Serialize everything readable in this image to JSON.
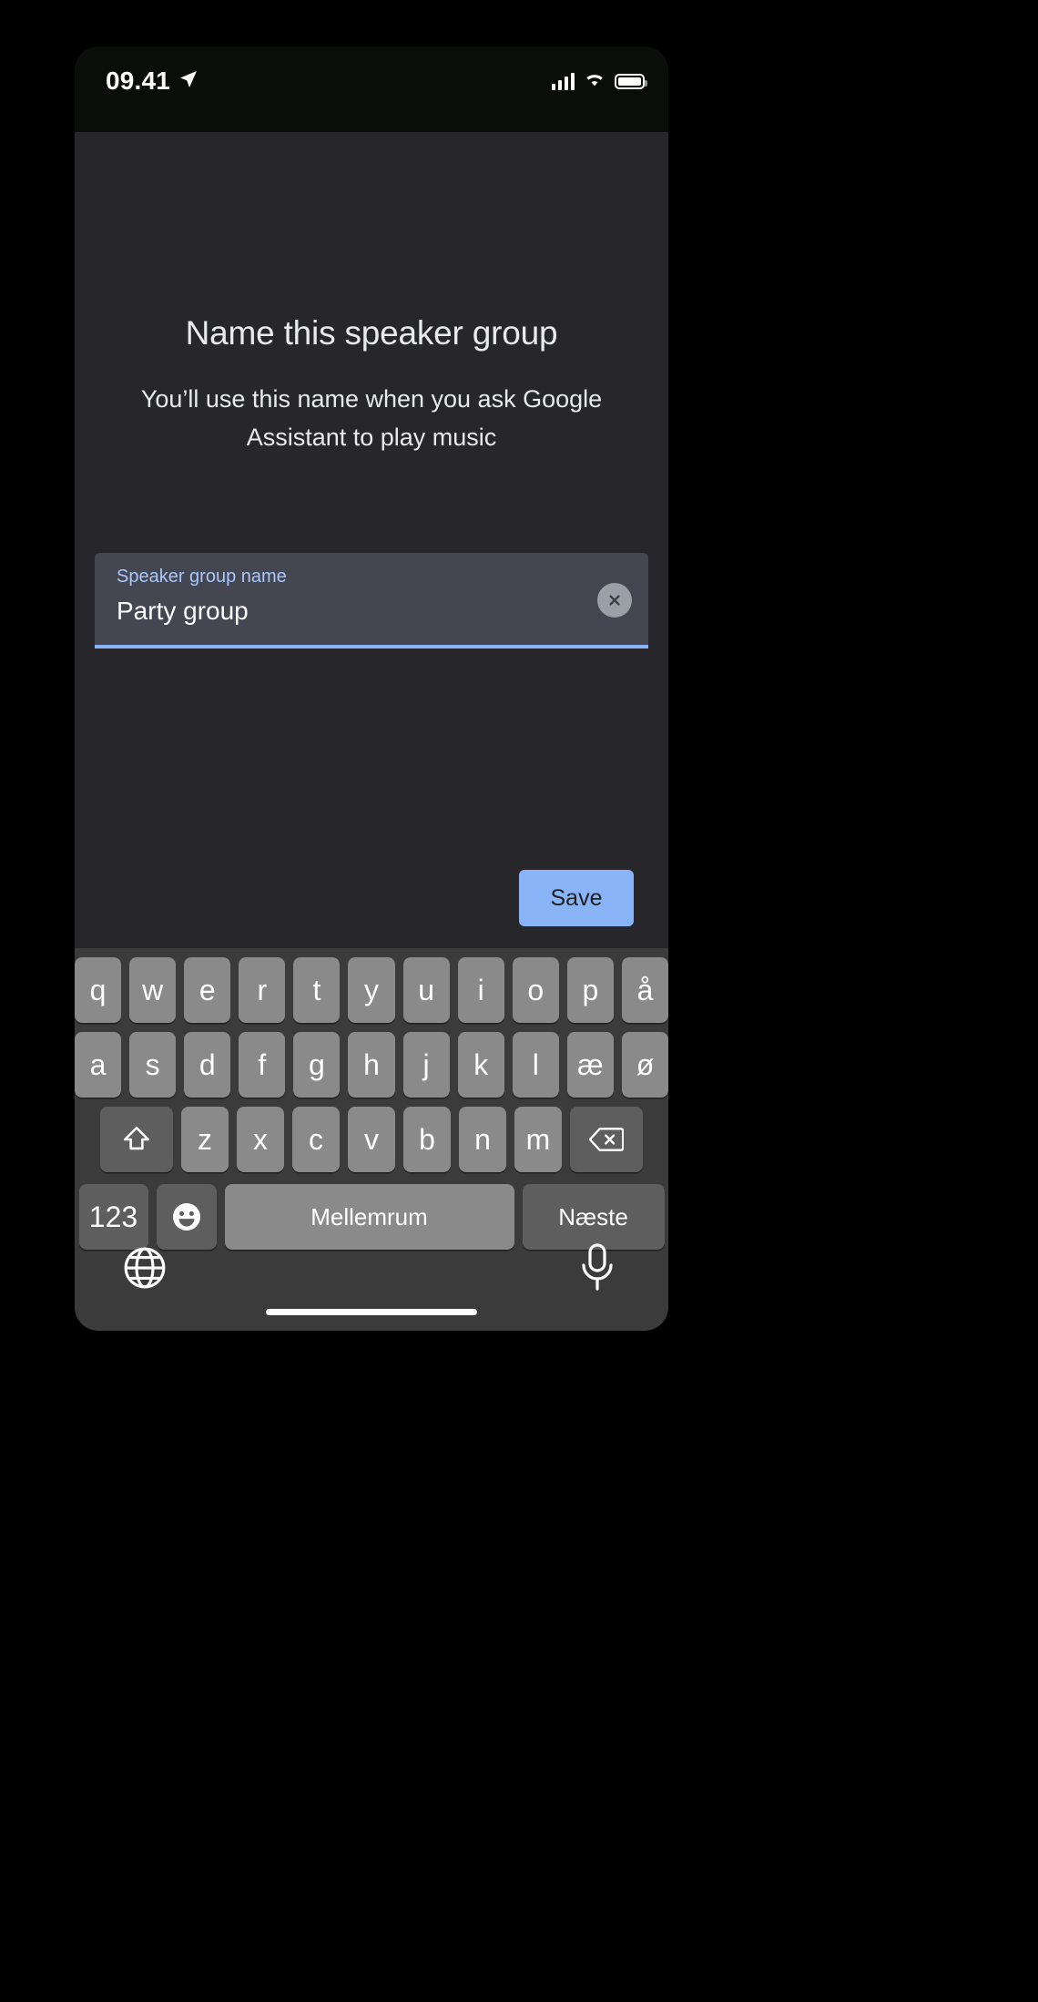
{
  "status_bar": {
    "time": "09.41",
    "location_icon": "location-arrow-icon",
    "signal_icon": "cellular-signal-icon",
    "wifi_icon": "wifi-icon",
    "battery_icon": "battery-full-icon"
  },
  "screen": {
    "title": "Name this speaker group",
    "subtitle": "You’ll use this name when you ask Google Assistant to play music"
  },
  "text_field": {
    "label": "Speaker group name",
    "value": "Party group",
    "placeholder": "Speaker group name",
    "clear_icon": "clear-circle-icon",
    "underline_color": "#8ab4f8",
    "label_color": "#a8c7fa"
  },
  "actions": {
    "save_label": "Save",
    "save_color": "#8ab4f8"
  },
  "keyboard": {
    "language": "Danish",
    "row1": [
      "q",
      "w",
      "e",
      "r",
      "t",
      "y",
      "u",
      "i",
      "o",
      "p",
      "å"
    ],
    "row2": [
      "a",
      "s",
      "d",
      "f",
      "g",
      "h",
      "j",
      "k",
      "l",
      "æ",
      "ø"
    ],
    "row3": [
      "z",
      "x",
      "c",
      "v",
      "b",
      "n",
      "m"
    ],
    "shift_icon": "shift-arrow-icon",
    "backspace_icon": "backspace-icon",
    "numbers_label": "123",
    "emoji_icon": "emoji-smiley-icon",
    "space_label": "Mellemrum",
    "next_label": "Næste",
    "globe_icon": "globe-icon",
    "mic_icon": "microphone-icon",
    "key_color": "#8a8a8a",
    "modifier_color": "#5e5e5e",
    "background_color": "#3b3b3b"
  }
}
